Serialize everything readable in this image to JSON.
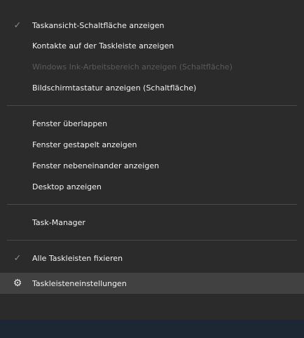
{
  "menu": {
    "items": [
      {
        "label": "Taskansicht-Schaltfläche anzeigen",
        "checked": true,
        "enabled": true
      },
      {
        "label": "Kontakte auf der Taskleiste anzeigen",
        "checked": false,
        "enabled": true
      },
      {
        "label": "Windows Ink-Arbeitsbereich anzeigen (Schaltfläche)",
        "checked": false,
        "enabled": false
      },
      {
        "label": "Bildschirmtastatur anzeigen (Schaltfläche)",
        "checked": false,
        "enabled": true
      },
      {
        "label": "Fenster überlappen",
        "checked": false,
        "enabled": true
      },
      {
        "label": "Fenster gestapelt anzeigen",
        "checked": false,
        "enabled": true
      },
      {
        "label": "Fenster nebeneinander anzeigen",
        "checked": false,
        "enabled": true
      },
      {
        "label": "Desktop anzeigen",
        "checked": false,
        "enabled": true
      },
      {
        "label": "Task-Manager",
        "checked": false,
        "enabled": true
      },
      {
        "label": "Alle Taskleisten fixieren",
        "checked": true,
        "enabled": true
      },
      {
        "label": "Taskleisteneinstellungen",
        "checked": false,
        "enabled": true,
        "icon": "gear-icon",
        "highlighted": true
      }
    ],
    "check_glyph": "✓",
    "gear_glyph": "⚙"
  },
  "colors": {
    "menu_background": "#2b2b2b",
    "text": "#f2f2f2",
    "disabled_text": "#5a5a5a",
    "separator": "#4a4a4a",
    "hover_background": "#414141",
    "taskbar": "#1d2733"
  }
}
